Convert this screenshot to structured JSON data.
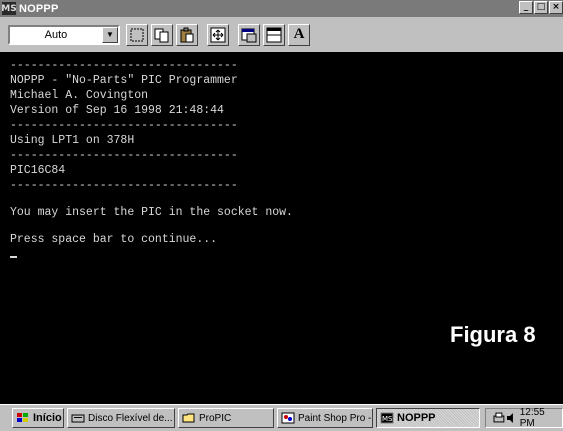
{
  "window": {
    "title": "NOPPP",
    "icon_text": "MS"
  },
  "window_controls": [
    "_",
    "□",
    "×"
  ],
  "toolbar": {
    "font_size_value": "Auto",
    "font_button_label": "A",
    "icons": [
      "mark-icon",
      "copy-icon",
      "paste-icon",
      "fullscreen-icon",
      "properties-icon",
      "background-icon",
      "font-icon"
    ]
  },
  "console": {
    "lines": [
      "---------------------------------",
      "NOPPP - \"No-Parts\" PIC Programmer",
      "Michael A. Covington",
      "Version of Sep 16 1998 21:48:44",
      "---------------------------------",
      "Using LPT1 on 378H",
      "---------------------------------",
      "PIC16C84",
      "---------------------------------",
      "",
      "You may insert the PIC in the socket now.",
      "",
      "Press space bar to continue..."
    ]
  },
  "caption": "Figura 8",
  "taskbar": {
    "start_label": "Início",
    "tasks": [
      "Disco Flexível de...",
      "ProPIC",
      "Paint Shop Pro - ...",
      "NOPPP"
    ],
    "clock": "12:55 PM"
  }
}
